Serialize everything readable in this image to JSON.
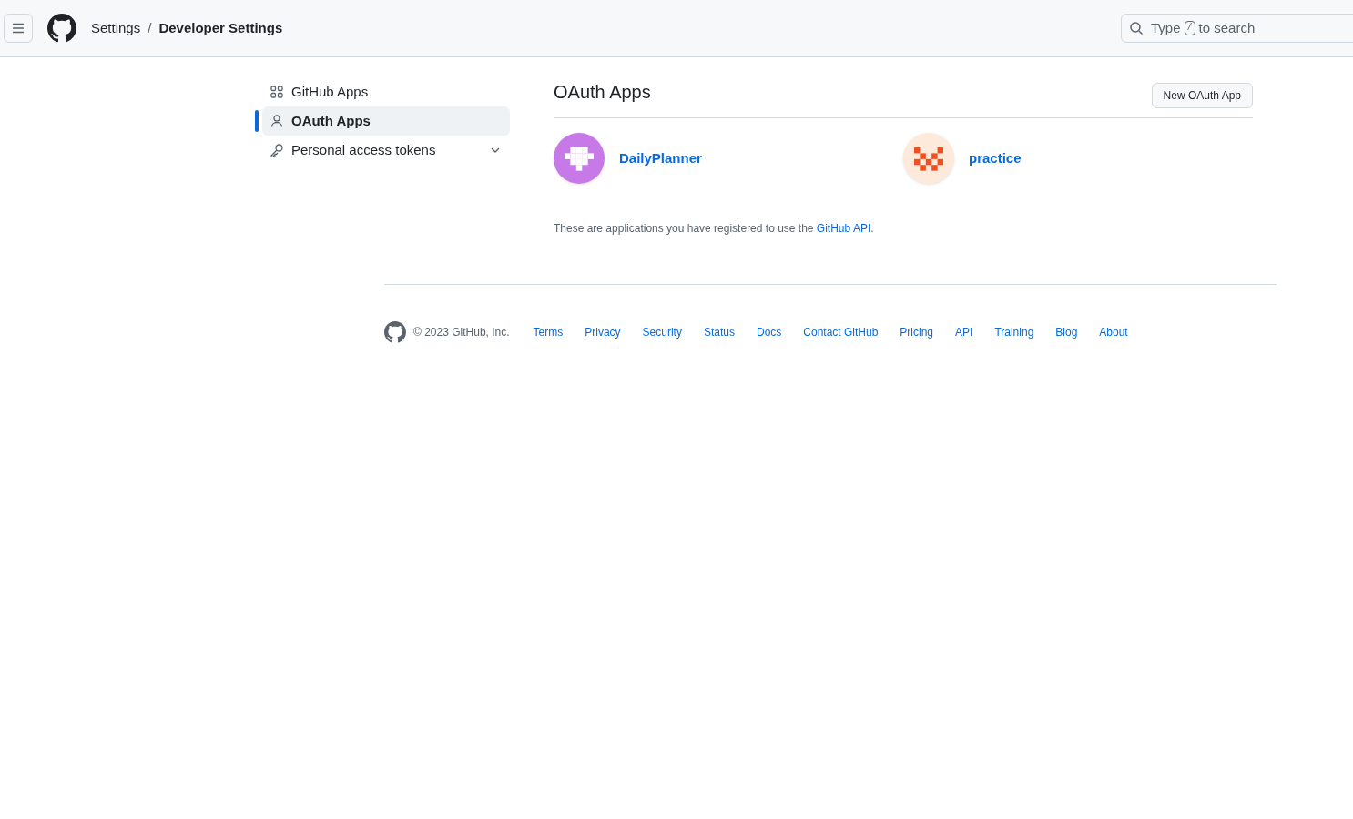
{
  "header": {
    "breadcrumb": [
      "Settings",
      "Developer Settings"
    ],
    "separator": "/",
    "search": {
      "placeholder_before": "Type",
      "key": "/",
      "placeholder_after": "to search"
    }
  },
  "sidebar": {
    "items": [
      {
        "label": "GitHub Apps",
        "kind": "apps",
        "selected": false
      },
      {
        "label": "OAuth Apps",
        "kind": "person",
        "selected": true
      },
      {
        "label": "Personal access tokens",
        "kind": "key",
        "selected": false,
        "expanded": false
      }
    ]
  },
  "main": {
    "title": "OAuth Apps",
    "new_button": "New OAuth App",
    "apps": [
      {
        "name": "DailyPlanner",
        "color": "#c879e8",
        "kind": "figure"
      },
      {
        "name": "practice",
        "color": "#f0501e",
        "kind": "checker"
      }
    ],
    "note": {
      "text": "These are applications you have registered to use the",
      "link": "GitHub API",
      "after": "."
    }
  },
  "footer": {
    "copyright": "© 2023 GitHub, Inc.",
    "links": [
      "Terms",
      "Privacy",
      "Security",
      "Status",
      "Docs",
      "Contact GitHub",
      "Pricing",
      "API",
      "Training",
      "Blog",
      "About"
    ]
  }
}
